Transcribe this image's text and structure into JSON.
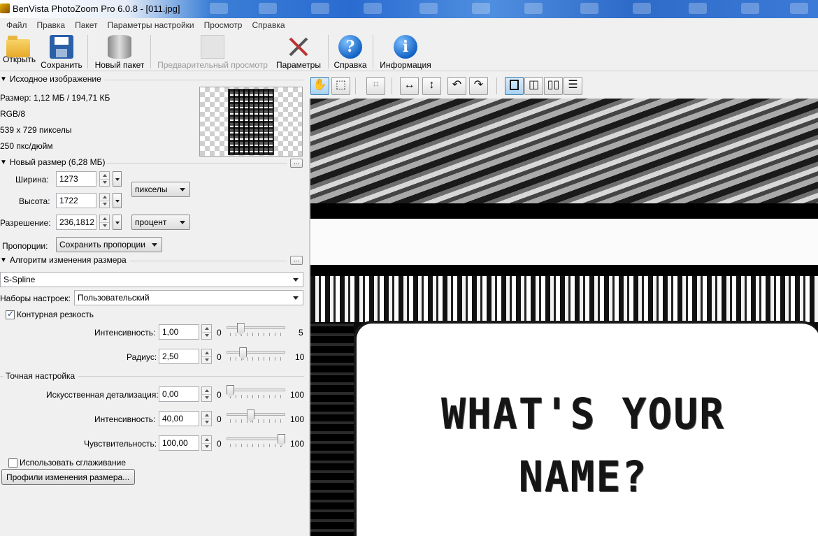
{
  "window": {
    "title": "BenVista PhotoZoom Pro 6.0.8 - [011.jpg]"
  },
  "menu": [
    "Файл",
    "Правка",
    "Пакет",
    "Параметры настройки",
    "Просмотр",
    "Справка"
  ],
  "toolbar": {
    "open": "Открыть",
    "save": "Сохранить",
    "new_batch": "Новый пакет",
    "preview": "Предварительный просмотр",
    "settings": "Параметры",
    "help": "Справка",
    "info": "Информация"
  },
  "source": {
    "header": "Исходное изображение",
    "size": "Размер: 1,12 МБ / 194,71 КБ",
    "mode": "RGB/8",
    "dimensions": "539 x 729 пикселы",
    "resolution": "250 пкс/дюйм"
  },
  "new_size": {
    "header": "Новый размер (6,28 МБ)",
    "width_label": "Ширина:",
    "width_value": "1273",
    "height_label": "Высота:",
    "height_value": "1722",
    "resolution_label": "Разрешение:",
    "resolution_value": "236,1812",
    "unit_size": "пикселы",
    "unit_resolution": "процент",
    "proportions_label": "Пропорции:",
    "proportions_value": "Сохранить пропорции"
  },
  "algorithm": {
    "header": "Алгоритм изменения размера",
    "method": "S-Spline",
    "presets_label": "Наборы настроек:",
    "presets_value": "Пользовательский"
  },
  "sharpness": {
    "label": "Контурная резкость",
    "checked": true,
    "intensity_label": "Интенсивность:",
    "intensity_value": "1,00",
    "intensity_min": "0",
    "intensity_max": "5",
    "intensity_level": 0.2,
    "radius_label": "Радиус:",
    "radius_value": "2,50",
    "radius_min": "0",
    "radius_max": "10",
    "radius_level": 0.25
  },
  "fine_tuning": {
    "header": "Точная настройка",
    "artificial_label": "Искусственная детализация:",
    "artificial_value": "0,00",
    "artificial_min": "0",
    "artificial_max": "100",
    "artificial_level": 0.0,
    "intensity_label": "Интенсивность:",
    "intensity_value": "40,00",
    "intensity_min": "0",
    "intensity_max": "100",
    "intensity_level": 0.4,
    "sensitivity_label": "Чувствительность:",
    "sensitivity_value": "100,00",
    "sensitivity_min": "0",
    "sensitivity_max": "100",
    "sensitivity_level": 1.0
  },
  "smoothing": {
    "label": "Использовать сглаживание",
    "checked": false
  },
  "profiles_button": "Профили изменения размера...",
  "preview_text": {
    "line1": "WHAT'S YOUR",
    "line2": "NAME?"
  }
}
